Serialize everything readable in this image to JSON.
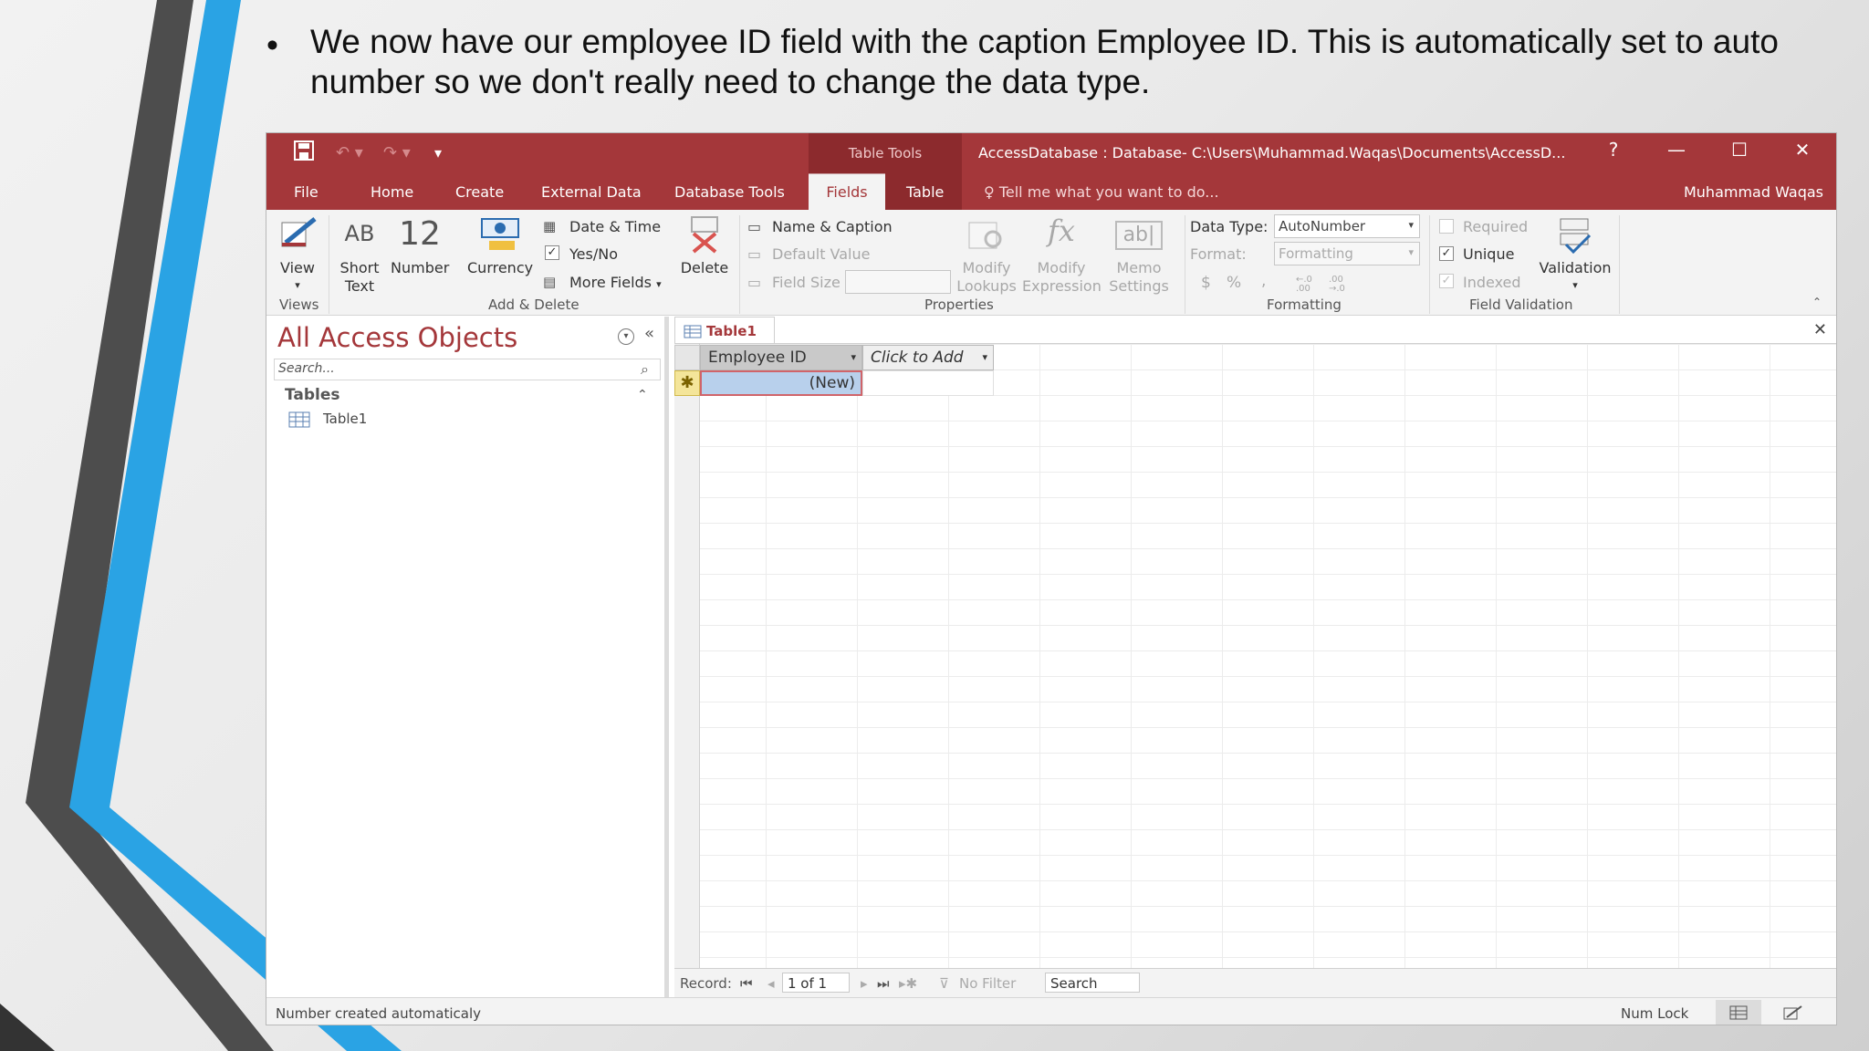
{
  "slide": {
    "bullet_marker": "•",
    "bullet_text": "We now have our employee ID field with the caption Employee ID. This is automatically set to auto number so we don't really need to change the data type."
  },
  "window": {
    "tools_label": "Table Tools",
    "title": "AccessDatabase : Database- C:\\Users\\Muhammad.Waqas\\Documents\\AccessD...",
    "help": "?",
    "minimize": "—",
    "maximize": "☐",
    "close": "✕",
    "user": "Muhammad Waqas",
    "tell_me": "Tell me what you want to do..."
  },
  "tabs": [
    "File",
    "Home",
    "Create",
    "External Data",
    "Database Tools",
    "Fields",
    "Table"
  ],
  "ribbon": {
    "views": {
      "view": "View",
      "group": "Views"
    },
    "add_delete": {
      "short_text_icon": "AB",
      "short_text": "Short Text",
      "number_icon": "12",
      "number": "Number",
      "currency": "Currency",
      "date_time": "Date & Time",
      "yes_no": "Yes/No",
      "more_fields": "More Fields",
      "delete": "Delete",
      "group": "Add & Delete"
    },
    "properties": {
      "name_caption": "Name & Caption",
      "default_value": "Default Value",
      "field_size": "Field Size",
      "modify_lookups": "Modify Lookups",
      "modify_expression": "Modify Expression",
      "memo_settings": "Memo Settings",
      "group": "Properties"
    },
    "formatting": {
      "data_type_label": "Data Type:",
      "data_type_value": "AutoNumber",
      "format_label": "Format:",
      "format_value": "Formatting",
      "dollar": "$",
      "percent": "%",
      "comma": ",",
      "inc_dec": "←.0 .00",
      "dec_dec": ".00 →.0",
      "group": "Formatting"
    },
    "validation": {
      "required": "Required",
      "unique": "Unique",
      "indexed": "Indexed",
      "validation": "Validation",
      "group": "Field Validation"
    },
    "checked": {
      "yes_no": true,
      "required": false,
      "unique": true,
      "indexed": true
    }
  },
  "nav": {
    "title": "All Access Objects",
    "search_placeholder": "Search...",
    "section": "Tables",
    "items": [
      "Table1"
    ]
  },
  "doc": {
    "tab": "Table1",
    "columns": [
      "Employee ID",
      "Click to Add"
    ],
    "new_row_value": "(New)",
    "new_marker": "✱"
  },
  "record_nav": {
    "label": "Record:",
    "position": "1 of 1",
    "filter": "No Filter",
    "search": "Search"
  },
  "status": {
    "message": "Number created automaticaly",
    "num_lock": "Num Lock"
  },
  "colors": {
    "accent": "#a4373a",
    "accent_dark": "#8c2a2d",
    "stripe_blue": "#2ba3e3",
    "stripe_gray": "#4a4a4a"
  }
}
